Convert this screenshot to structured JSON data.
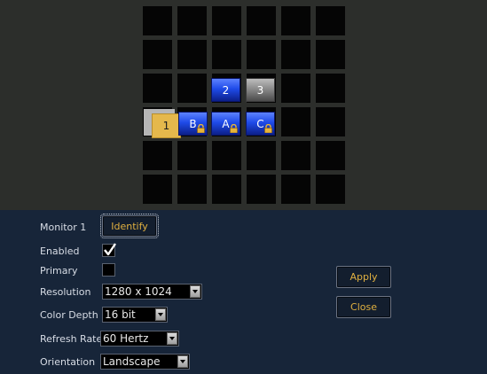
{
  "layout": {
    "tiles": [
      {
        "label": "2",
        "style": "blue",
        "locked": false
      },
      {
        "label": "3",
        "style": "gray",
        "locked": false
      },
      {
        "label": "B",
        "style": "blue",
        "locked": true
      },
      {
        "label": "A",
        "style": "blue",
        "locked": true
      },
      {
        "label": "C",
        "style": "blue",
        "locked": true
      }
    ],
    "selected_monitor": "1",
    "icons": {
      "lock": "padlock-icon"
    }
  },
  "form": {
    "monitor_label": "Monitor 1",
    "identify_label": "Identify",
    "enabled_label": "Enabled",
    "enabled_checked": true,
    "primary_label": "Primary",
    "primary_checked": false,
    "resolution_label": "Resolution",
    "resolution_value": "1280 x 1024",
    "color_depth_label": "Color Depth",
    "color_depth_value": "16 bit",
    "refresh_rate_label": "Refresh Rate",
    "refresh_rate_value": "60 Hertz",
    "orientation_label": "Orientation",
    "orientation_value": "Landscape"
  },
  "actions": {
    "apply_label": "Apply",
    "close_label": "Close"
  },
  "colors": {
    "panel_bg": "#172539",
    "layout_bg": "#2c2e2b",
    "button_text": "#e0b040",
    "selected_tile": "#e5b84c"
  }
}
